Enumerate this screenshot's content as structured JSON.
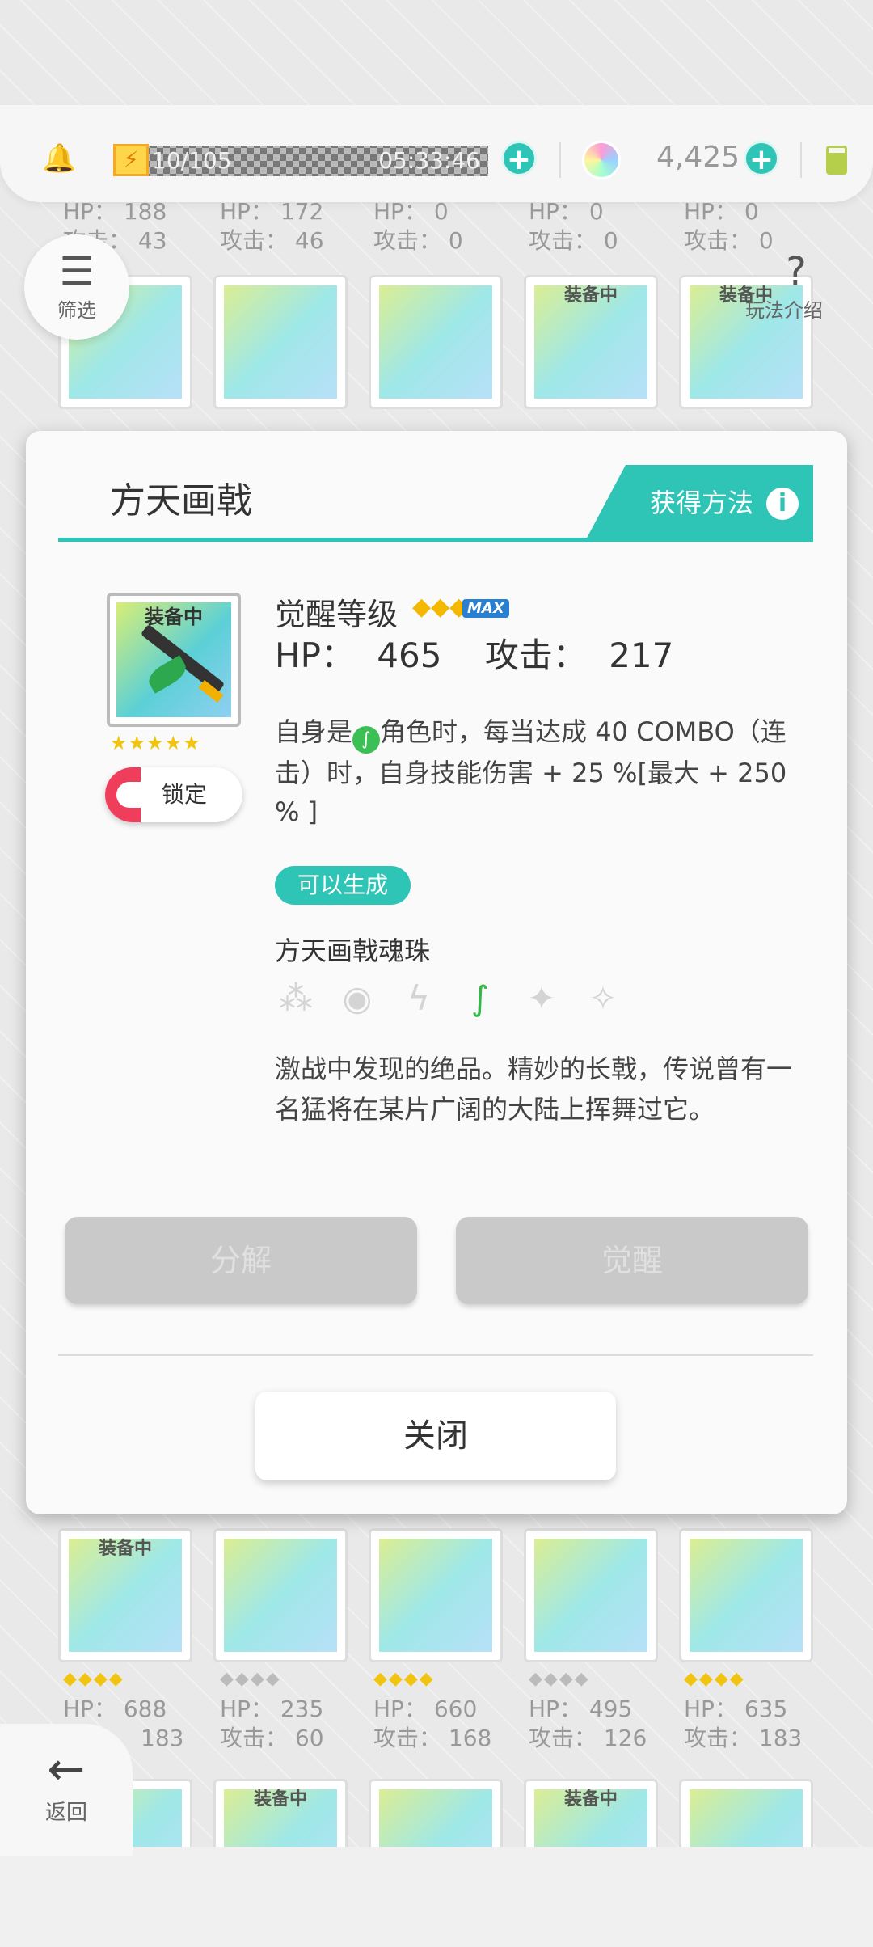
{
  "topbar": {
    "stamina_value": "10/105",
    "stamina_timer": "05:33:46",
    "gem_count": "4,425"
  },
  "side": {
    "filter_label": "筛选",
    "help_label": "玩法介绍",
    "back_label": "返回"
  },
  "bg_items_top": [
    {
      "hp": "HP： 188",
      "atk": "攻击： 43",
      "equipped": ""
    },
    {
      "hp": "HP： 172",
      "atk": "攻击： 46",
      "equipped": ""
    },
    {
      "hp": "HP： 0",
      "atk": "攻击： 0",
      "equipped": ""
    },
    {
      "hp": "HP： 0",
      "atk": "攻击： 0",
      "equipped": "装备中"
    },
    {
      "hp": "HP： 0",
      "atk": "攻击： 0",
      "equipped": "装备中"
    }
  ],
  "bg_items_bottom": [
    {
      "hp": "HP： 688",
      "atk": "183",
      "equipped": "装备中"
    },
    {
      "hp": "HP： 235",
      "atk": "攻击： 60",
      "equipped": ""
    },
    {
      "hp": "HP： 660",
      "atk": "攻击： 168",
      "equipped": ""
    },
    {
      "hp": "HP： 495",
      "atk": "攻击： 126",
      "equipped": ""
    },
    {
      "hp": "HP： 635",
      "atk": "攻击： 183",
      "equipped": ""
    }
  ],
  "bg_items_row3": [
    {
      "equipped": ""
    },
    {
      "equipped": "装备中"
    },
    {
      "equipped": ""
    },
    {
      "equipped": "装备中"
    },
    {
      "equipped": ""
    }
  ],
  "modal": {
    "title": "方天画戟",
    "obtain_label": "获得方法",
    "equipped_tag": "装备中",
    "card_stars": "★★★★★",
    "lock_label": "锁定",
    "awaken_label": "觉醒等级",
    "awaken_max": "MAX",
    "hp_label": "HP：",
    "hp_value": "465",
    "atk_label": "攻击：",
    "atk_value": "217",
    "skill_prefix": "自身是",
    "skill_suffix": "角色时，每当达成 40 COMBO（连击）时，自身技能伤害 + 25 %[最大 + 250 % ]",
    "can_generate": "可以生成",
    "orb_name": "方天画戟魂珠",
    "description": "激战中发现的绝品。精妙的长戟，传说曾有一名猛将在某片广阔的大陆上挥舞过它。",
    "decompose_label": "分解",
    "awaken_button_label": "觉醒",
    "close_label": "关闭"
  }
}
